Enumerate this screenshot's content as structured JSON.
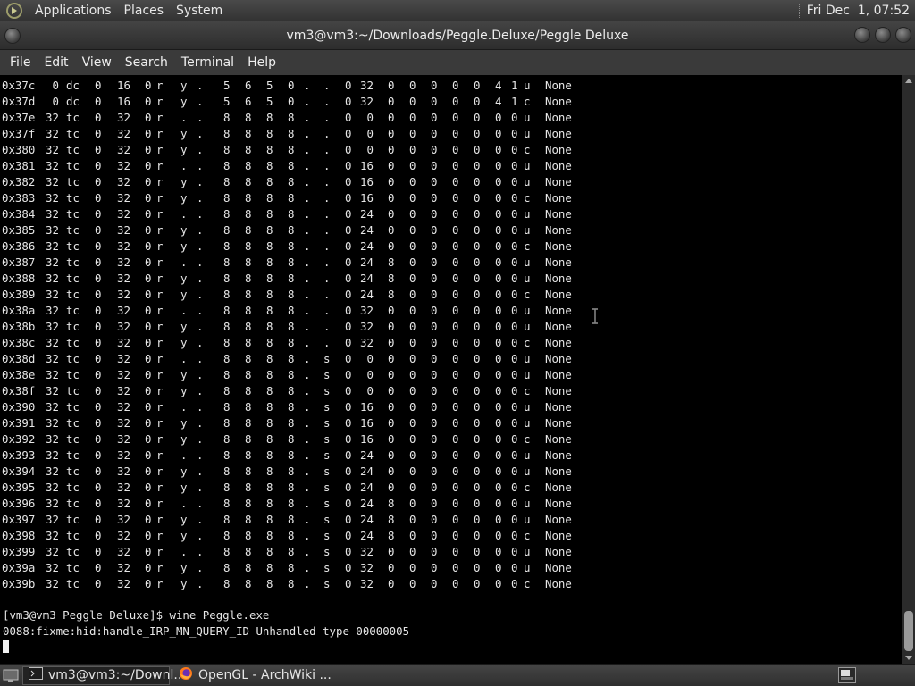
{
  "top_panel": {
    "menus": [
      "Applications",
      "Places",
      "System"
    ],
    "clock": "Fri Dec  1, 07:52"
  },
  "window": {
    "title": "vm3@vm3:~/Downloads/Peggle.Deluxe/Peggle Deluxe"
  },
  "menubar": {
    "items": [
      "File",
      "Edit",
      "View",
      "Search",
      "Terminal",
      "Help"
    ]
  },
  "terminal": {
    "table_rows": [
      [
        "0x37c",
        "0",
        "dc",
        "0",
        "16",
        "0",
        "r",
        "y",
        ".",
        "5",
        "6",
        "5",
        "0",
        ".",
        ".",
        "0",
        "32",
        "0",
        "0",
        "0",
        "0",
        "0",
        "4",
        "1",
        "u",
        "None"
      ],
      [
        "0x37d",
        "0",
        "dc",
        "0",
        "16",
        "0",
        "r",
        "y",
        ".",
        "5",
        "6",
        "5",
        "0",
        ".",
        ".",
        "0",
        "32",
        "0",
        "0",
        "0",
        "0",
        "0",
        "4",
        "1",
        "c",
        "None"
      ],
      [
        "0x37e",
        "32",
        "tc",
        "0",
        "32",
        "0",
        "r",
        ".",
        ".",
        "8",
        "8",
        "8",
        "8",
        ".",
        ".",
        "0",
        "0",
        "0",
        "0",
        "0",
        "0",
        "0",
        "0",
        "0",
        "u",
        "None"
      ],
      [
        "0x37f",
        "32",
        "tc",
        "0",
        "32",
        "0",
        "r",
        "y",
        ".",
        "8",
        "8",
        "8",
        "8",
        ".",
        ".",
        "0",
        "0",
        "0",
        "0",
        "0",
        "0",
        "0",
        "0",
        "0",
        "u",
        "None"
      ],
      [
        "0x380",
        "32",
        "tc",
        "0",
        "32",
        "0",
        "r",
        "y",
        ".",
        "8",
        "8",
        "8",
        "8",
        ".",
        ".",
        "0",
        "0",
        "0",
        "0",
        "0",
        "0",
        "0",
        "0",
        "0",
        "c",
        "None"
      ],
      [
        "0x381",
        "32",
        "tc",
        "0",
        "32",
        "0",
        "r",
        ".",
        ".",
        "8",
        "8",
        "8",
        "8",
        ".",
        ".",
        "0",
        "16",
        "0",
        "0",
        "0",
        "0",
        "0",
        "0",
        "0",
        "u",
        "None"
      ],
      [
        "0x382",
        "32",
        "tc",
        "0",
        "32",
        "0",
        "r",
        "y",
        ".",
        "8",
        "8",
        "8",
        "8",
        ".",
        ".",
        "0",
        "16",
        "0",
        "0",
        "0",
        "0",
        "0",
        "0",
        "0",
        "u",
        "None"
      ],
      [
        "0x383",
        "32",
        "tc",
        "0",
        "32",
        "0",
        "r",
        "y",
        ".",
        "8",
        "8",
        "8",
        "8",
        ".",
        ".",
        "0",
        "16",
        "0",
        "0",
        "0",
        "0",
        "0",
        "0",
        "0",
        "c",
        "None"
      ],
      [
        "0x384",
        "32",
        "tc",
        "0",
        "32",
        "0",
        "r",
        ".",
        ".",
        "8",
        "8",
        "8",
        "8",
        ".",
        ".",
        "0",
        "24",
        "0",
        "0",
        "0",
        "0",
        "0",
        "0",
        "0",
        "u",
        "None"
      ],
      [
        "0x385",
        "32",
        "tc",
        "0",
        "32",
        "0",
        "r",
        "y",
        ".",
        "8",
        "8",
        "8",
        "8",
        ".",
        ".",
        "0",
        "24",
        "0",
        "0",
        "0",
        "0",
        "0",
        "0",
        "0",
        "u",
        "None"
      ],
      [
        "0x386",
        "32",
        "tc",
        "0",
        "32",
        "0",
        "r",
        "y",
        ".",
        "8",
        "8",
        "8",
        "8",
        ".",
        ".",
        "0",
        "24",
        "0",
        "0",
        "0",
        "0",
        "0",
        "0",
        "0",
        "c",
        "None"
      ],
      [
        "0x387",
        "32",
        "tc",
        "0",
        "32",
        "0",
        "r",
        ".",
        ".",
        "8",
        "8",
        "8",
        "8",
        ".",
        ".",
        "0",
        "24",
        "8",
        "0",
        "0",
        "0",
        "0",
        "0",
        "0",
        "u",
        "None"
      ],
      [
        "0x388",
        "32",
        "tc",
        "0",
        "32",
        "0",
        "r",
        "y",
        ".",
        "8",
        "8",
        "8",
        "8",
        ".",
        ".",
        "0",
        "24",
        "8",
        "0",
        "0",
        "0",
        "0",
        "0",
        "0",
        "u",
        "None"
      ],
      [
        "0x389",
        "32",
        "tc",
        "0",
        "32",
        "0",
        "r",
        "y",
        ".",
        "8",
        "8",
        "8",
        "8",
        ".",
        ".",
        "0",
        "24",
        "8",
        "0",
        "0",
        "0",
        "0",
        "0",
        "0",
        "c",
        "None"
      ],
      [
        "0x38a",
        "32",
        "tc",
        "0",
        "32",
        "0",
        "r",
        ".",
        ".",
        "8",
        "8",
        "8",
        "8",
        ".",
        ".",
        "0",
        "32",
        "0",
        "0",
        "0",
        "0",
        "0",
        "0",
        "0",
        "u",
        "None"
      ],
      [
        "0x38b",
        "32",
        "tc",
        "0",
        "32",
        "0",
        "r",
        "y",
        ".",
        "8",
        "8",
        "8",
        "8",
        ".",
        ".",
        "0",
        "32",
        "0",
        "0",
        "0",
        "0",
        "0",
        "0",
        "0",
        "u",
        "None"
      ],
      [
        "0x38c",
        "32",
        "tc",
        "0",
        "32",
        "0",
        "r",
        "y",
        ".",
        "8",
        "8",
        "8",
        "8",
        ".",
        ".",
        "0",
        "32",
        "0",
        "0",
        "0",
        "0",
        "0",
        "0",
        "0",
        "c",
        "None"
      ],
      [
        "0x38d",
        "32",
        "tc",
        "0",
        "32",
        "0",
        "r",
        ".",
        ".",
        "8",
        "8",
        "8",
        "8",
        ".",
        "s",
        "0",
        "0",
        "0",
        "0",
        "0",
        "0",
        "0",
        "0",
        "0",
        "u",
        "None"
      ],
      [
        "0x38e",
        "32",
        "tc",
        "0",
        "32",
        "0",
        "r",
        "y",
        ".",
        "8",
        "8",
        "8",
        "8",
        ".",
        "s",
        "0",
        "0",
        "0",
        "0",
        "0",
        "0",
        "0",
        "0",
        "0",
        "u",
        "None"
      ],
      [
        "0x38f",
        "32",
        "tc",
        "0",
        "32",
        "0",
        "r",
        "y",
        ".",
        "8",
        "8",
        "8",
        "8",
        ".",
        "s",
        "0",
        "0",
        "0",
        "0",
        "0",
        "0",
        "0",
        "0",
        "0",
        "c",
        "None"
      ],
      [
        "0x390",
        "32",
        "tc",
        "0",
        "32",
        "0",
        "r",
        ".",
        ".",
        "8",
        "8",
        "8",
        "8",
        ".",
        "s",
        "0",
        "16",
        "0",
        "0",
        "0",
        "0",
        "0",
        "0",
        "0",
        "u",
        "None"
      ],
      [
        "0x391",
        "32",
        "tc",
        "0",
        "32",
        "0",
        "r",
        "y",
        ".",
        "8",
        "8",
        "8",
        "8",
        ".",
        "s",
        "0",
        "16",
        "0",
        "0",
        "0",
        "0",
        "0",
        "0",
        "0",
        "u",
        "None"
      ],
      [
        "0x392",
        "32",
        "tc",
        "0",
        "32",
        "0",
        "r",
        "y",
        ".",
        "8",
        "8",
        "8",
        "8",
        ".",
        "s",
        "0",
        "16",
        "0",
        "0",
        "0",
        "0",
        "0",
        "0",
        "0",
        "c",
        "None"
      ],
      [
        "0x393",
        "32",
        "tc",
        "0",
        "32",
        "0",
        "r",
        ".",
        ".",
        "8",
        "8",
        "8",
        "8",
        ".",
        "s",
        "0",
        "24",
        "0",
        "0",
        "0",
        "0",
        "0",
        "0",
        "0",
        "u",
        "None"
      ],
      [
        "0x394",
        "32",
        "tc",
        "0",
        "32",
        "0",
        "r",
        "y",
        ".",
        "8",
        "8",
        "8",
        "8",
        ".",
        "s",
        "0",
        "24",
        "0",
        "0",
        "0",
        "0",
        "0",
        "0",
        "0",
        "u",
        "None"
      ],
      [
        "0x395",
        "32",
        "tc",
        "0",
        "32",
        "0",
        "r",
        "y",
        ".",
        "8",
        "8",
        "8",
        "8",
        ".",
        "s",
        "0",
        "24",
        "0",
        "0",
        "0",
        "0",
        "0",
        "0",
        "0",
        "c",
        "None"
      ],
      [
        "0x396",
        "32",
        "tc",
        "0",
        "32",
        "0",
        "r",
        ".",
        ".",
        "8",
        "8",
        "8",
        "8",
        ".",
        "s",
        "0",
        "24",
        "8",
        "0",
        "0",
        "0",
        "0",
        "0",
        "0",
        "u",
        "None"
      ],
      [
        "0x397",
        "32",
        "tc",
        "0",
        "32",
        "0",
        "r",
        "y",
        ".",
        "8",
        "8",
        "8",
        "8",
        ".",
        "s",
        "0",
        "24",
        "8",
        "0",
        "0",
        "0",
        "0",
        "0",
        "0",
        "u",
        "None"
      ],
      [
        "0x398",
        "32",
        "tc",
        "0",
        "32",
        "0",
        "r",
        "y",
        ".",
        "8",
        "8",
        "8",
        "8",
        ".",
        "s",
        "0",
        "24",
        "8",
        "0",
        "0",
        "0",
        "0",
        "0",
        "0",
        "c",
        "None"
      ],
      [
        "0x399",
        "32",
        "tc",
        "0",
        "32",
        "0",
        "r",
        ".",
        ".",
        "8",
        "8",
        "8",
        "8",
        ".",
        "s",
        "0",
        "32",
        "0",
        "0",
        "0",
        "0",
        "0",
        "0",
        "0",
        "u",
        "None"
      ],
      [
        "0x39a",
        "32",
        "tc",
        "0",
        "32",
        "0",
        "r",
        "y",
        ".",
        "8",
        "8",
        "8",
        "8",
        ".",
        "s",
        "0",
        "32",
        "0",
        "0",
        "0",
        "0",
        "0",
        "0",
        "0",
        "u",
        "None"
      ],
      [
        "0x39b",
        "32",
        "tc",
        "0",
        "32",
        "0",
        "r",
        "y",
        ".",
        "8",
        "8",
        "8",
        "8",
        ".",
        "s",
        "0",
        "32",
        "0",
        "0",
        "0",
        "0",
        "0",
        "0",
        "0",
        "c",
        "None"
      ]
    ],
    "prompt_line": "[vm3@vm3 Peggle Deluxe]$ wine Peggle.exe",
    "output_line": "0088:fixme:hid:handle_IRP_MN_QUERY_ID Unhandled type 00000005"
  },
  "taskbar": {
    "tasks": [
      {
        "label": "vm3@vm3:~/Downl...",
        "icon": "terminal-icon",
        "active": true
      },
      {
        "label": "OpenGL - ArchWiki ...",
        "icon": "firefox-icon",
        "active": false
      }
    ]
  },
  "colors": {
    "terminal_bg": "#000000",
    "terminal_fg": "#e6e6e6",
    "panel_bg": "#3a3a3a"
  }
}
